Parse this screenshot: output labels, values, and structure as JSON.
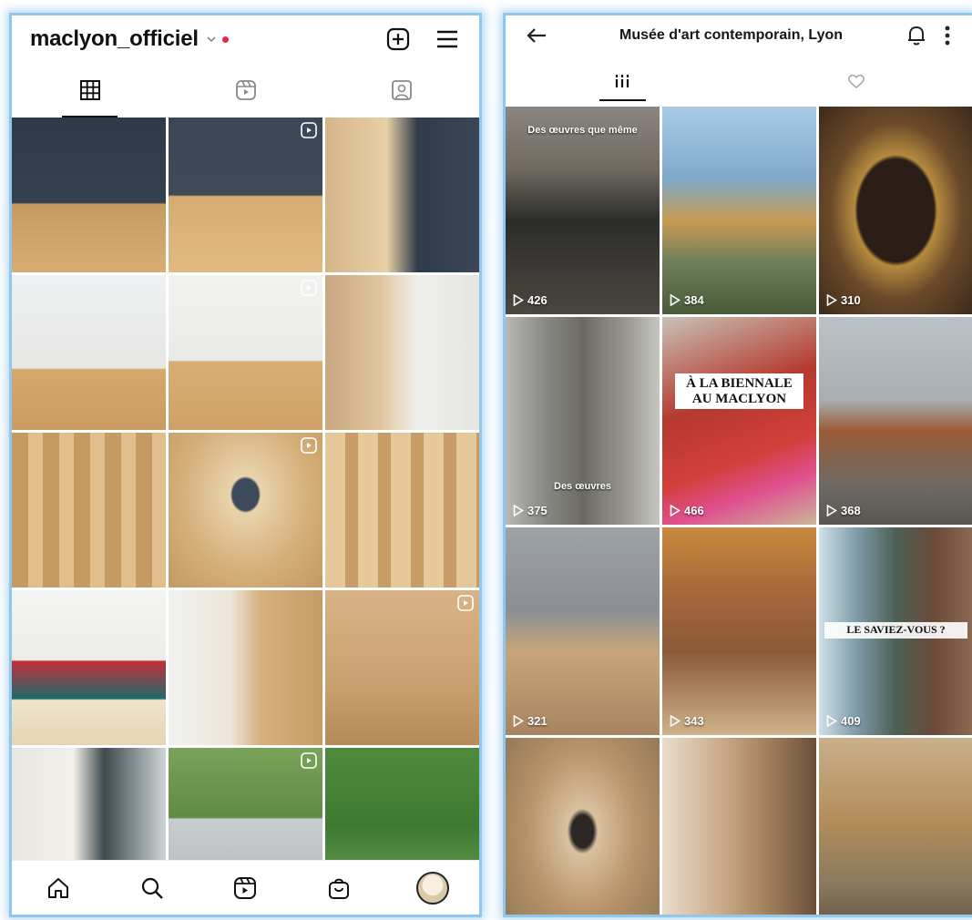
{
  "instagram": {
    "username": "maclyon_officiel",
    "icons": {
      "create": "plus-square-icon",
      "menu": "hamburger-menu-icon",
      "grid_tab": "grid-icon",
      "reels_tab": "reels-icon",
      "tagged_tab": "tagged-person-icon",
      "home": "home-icon",
      "search": "search-icon",
      "reels": "reels-icon",
      "shop": "shopping-bag-icon",
      "profile": "profile-avatar"
    },
    "notification_dot_color": "#e8254a",
    "tiles": [
      {
        "desc": "gallery-navy-walls",
        "reel": false
      },
      {
        "desc": "gallery-artworks-floor",
        "reel": true
      },
      {
        "desc": "wooden-crate-frame",
        "reel": false
      },
      {
        "desc": "white-room-scaffold",
        "reel": false
      },
      {
        "desc": "white-room-workers",
        "reel": true
      },
      {
        "desc": "doorway-installation",
        "reel": false
      },
      {
        "desc": "wood-stud-walls",
        "reel": false
      },
      {
        "desc": "wood-corridor",
        "reel": true
      },
      {
        "desc": "wood-panels",
        "reel": false
      },
      {
        "desc": "paintings-on-floor",
        "reel": false
      },
      {
        "desc": "crates-and-paintings",
        "reel": false
      },
      {
        "desc": "wooden-crates-room",
        "reel": true
      },
      {
        "desc": "gallery-window-painting",
        "reel": false
      },
      {
        "desc": "street-view-trees",
        "reel": true
      },
      {
        "desc": "green-trees",
        "reel": false
      }
    ]
  },
  "tiktok": {
    "title": "Musée d'art contemporain, Lyon",
    "icons": {
      "back": "back-arrow-icon",
      "notifications": "bell-icon",
      "more": "more-vertical-icon",
      "videos_tab": "videos-grid-icon",
      "liked_tab": "heart-liked-icon",
      "play": "play-icon"
    },
    "tiles": [
      {
        "views": "426",
        "caption": "Des œuvres que même",
        "banner": "",
        "color": "#6e6a62"
      },
      {
        "views": "384",
        "caption": "",
        "banner": "",
        "color": "#7fa9c9"
      },
      {
        "views": "310",
        "caption": "",
        "banner": "",
        "color": "#6b4a2a"
      },
      {
        "views": "375",
        "caption": "Des œuvres",
        "banner": "",
        "color": "#8a8a86"
      },
      {
        "views": "466",
        "caption": "",
        "banner": "À LA BIENNALE AU MACLYON",
        "color": "#b5392e"
      },
      {
        "views": "368",
        "caption": "",
        "banner": "",
        "color": "#8c7a6a"
      },
      {
        "views": "321",
        "caption": "",
        "banner": "",
        "color": "#8b8f93"
      },
      {
        "views": "343",
        "caption": "",
        "banner": "",
        "color": "#a3643a"
      },
      {
        "views": "409",
        "caption": "",
        "banner": "LE SAVIEZ-VOUS ?",
        "color": "#4b5f54"
      },
      {
        "views": "",
        "caption": "",
        "banner": "",
        "color": "#8c7455"
      },
      {
        "views": "",
        "caption": "",
        "banner": "",
        "color": "#a07d5a"
      },
      {
        "views": "",
        "caption": "",
        "banner": "",
        "color": "#8a7a5e"
      }
    ]
  }
}
